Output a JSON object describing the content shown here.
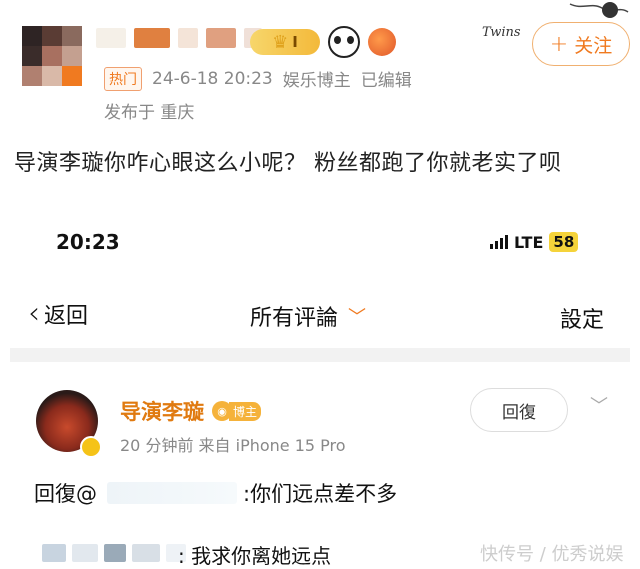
{
  "post": {
    "badge_level": "I",
    "follow_label": "关注",
    "follow_symbol": "+",
    "hot_tag": "热门",
    "datetime": "24-6-18 20:23",
    "author_role": "娱乐博主",
    "edited": "已编辑",
    "location": "发布于 重庆",
    "text": "导演李璇你咋心眼这么小呢？ 粉丝都跑了你就老实了呗",
    "watermark_signature": "Twins"
  },
  "screenshot": {
    "status_time": "20:23",
    "network": "LTE",
    "battery": "58",
    "back_label": "返回",
    "title": "所有评論",
    "settings_label": "設定",
    "comment": {
      "author": "导演李璇",
      "author_tag": "博主",
      "meta": "20 分钟前  来自 iPhone 15 Pro",
      "reply_button": "回復",
      "text_prefix": "回復@",
      "text_body": ":你们远点差不多"
    },
    "sub_reply": {
      "text": ": 我求你离她远点"
    },
    "bottom_watermark": "快传号 / 优秀说娱"
  },
  "colors": {
    "accent": "#f07a20",
    "author_name": "#e07a10",
    "meta_gray": "#888888"
  }
}
